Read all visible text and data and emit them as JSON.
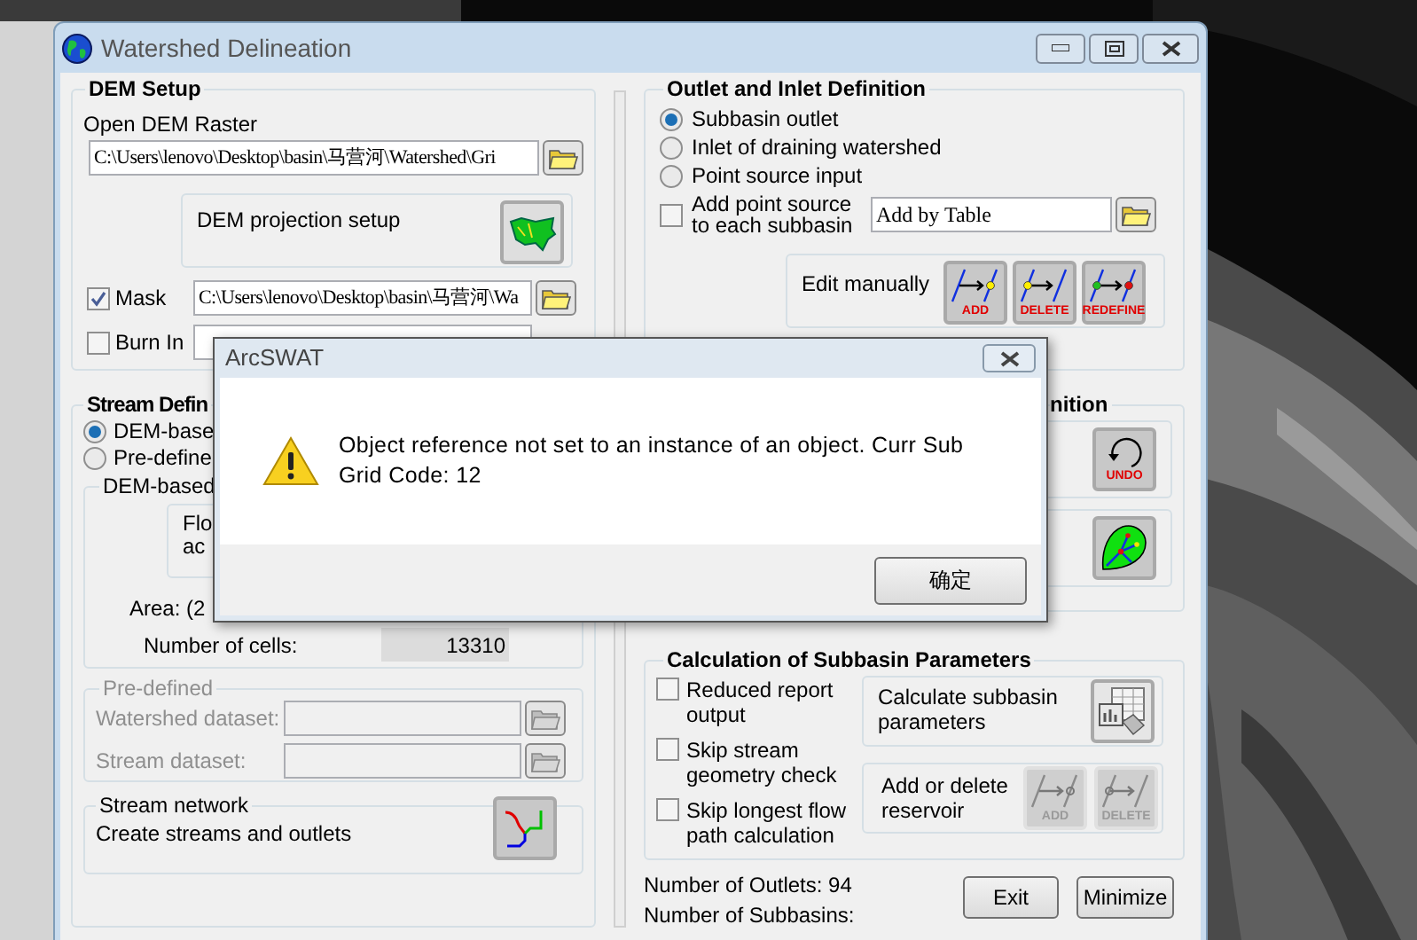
{
  "main_window": {
    "title": "Watershed Delineation"
  },
  "dem_setup": {
    "title": "DEM Setup",
    "open_label": "Open DEM Raster",
    "dem_path": "C:\\Users\\lenovo\\Desktop\\basin\\马营河\\Watershed\\Gri",
    "projection_label": "DEM projection setup",
    "mask": {
      "label": "Mask",
      "checked": true,
      "path": "C:\\Users\\lenovo\\Desktop\\basin\\马营河\\Wa"
    },
    "burn_in": {
      "label": "Burn In",
      "checked": false
    }
  },
  "stream_definition": {
    "title": "Stream Defin",
    "options": [
      {
        "label": "DEM-base",
        "selected": true
      },
      {
        "label": "Pre-define",
        "selected": false
      }
    ],
    "dem_based": {
      "title": "DEM-based",
      "text_lines": [
        "Flo",
        "ac"
      ],
      "area_label": "Area: (2",
      "cells_label": "Number of cells:",
      "cells_value": "13310"
    },
    "pre_defined": {
      "title": "Pre-defined",
      "disabled": true,
      "watershed_label": "Watershed dataset:",
      "stream_label": "Stream dataset:"
    },
    "stream_network": {
      "title": "Stream network",
      "text": "Create streams and outlets"
    }
  },
  "outlet": {
    "title": "Outlet and Inlet Definition",
    "options": [
      {
        "label": "Subbasin outlet",
        "selected": true
      },
      {
        "label": "Inlet of draining watershed",
        "selected": false
      },
      {
        "label": "Point source input",
        "selected": false
      }
    ],
    "add_point_source": {
      "label": "Add point source\nto each subbasin",
      "checked": false
    },
    "table_field": "Add by Table",
    "edit_manually": {
      "label": "Edit manually",
      "buttons": [
        {
          "kind": "add",
          "label": "ADD"
        },
        {
          "kind": "delete",
          "label": "DELETE"
        },
        {
          "kind": "redefine",
          "label": "REDEFINE"
        }
      ]
    }
  },
  "definition": {
    "title": "nition",
    "undo_label": "UNDO"
  },
  "calculation": {
    "title": "Calculation of Subbasin Parameters",
    "options": [
      {
        "label": "Reduced  report\noutput",
        "checked": false
      },
      {
        "label": "Skip stream\ngeometry check",
        "checked": false
      },
      {
        "label": "Skip longest flow\npath calculation",
        "checked": false
      }
    ],
    "calculate_label": "Calculate subbasin\nparameters",
    "reservoir": {
      "label": "Add or delete\nreservoir",
      "disabled": true,
      "buttons": [
        {
          "kind": "add",
          "label": "ADD"
        },
        {
          "kind": "delete",
          "label": "DELETE"
        }
      ]
    }
  },
  "footer": {
    "outlets": "Number of Outlets: 94",
    "subbasins": "Number of Subbasins:",
    "buttons": [
      "Exit",
      "Minimize"
    ]
  },
  "dialog": {
    "title": "ArcSWAT",
    "message": "Object reference not set to an instance of an object. Curr Sub\nGrid Code: 12",
    "ok": "确定"
  }
}
